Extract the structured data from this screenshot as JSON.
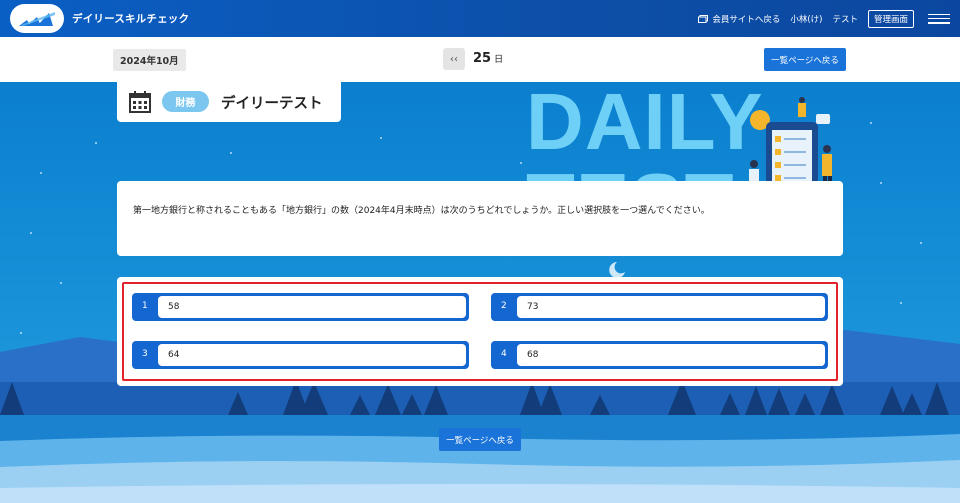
{
  "header": {
    "app_title": "デイリースキルチェック",
    "member_site": "会員サイトへ戻る",
    "user_name": "小林(け)",
    "test_link": "テスト",
    "admin_button": "管理画面"
  },
  "datebar": {
    "month": "2024年10月",
    "prev": "‹‹",
    "day": "25",
    "day_unit": "日",
    "list_button": "一覧ページへ戻る"
  },
  "card": {
    "category": "財務",
    "title": "デイリーテスト",
    "background_text": "DAILY TEST"
  },
  "question": {
    "text": "第一地方銀行と称されることもある「地方銀行」の数（2024年4月末時点）は次のうちどれでしょうか。正しい選択肢を一つ選んでください。"
  },
  "options": [
    {
      "num": "1",
      "value": "58"
    },
    {
      "num": "2",
      "value": "73"
    },
    {
      "num": "3",
      "value": "64"
    },
    {
      "num": "4",
      "value": "68"
    }
  ],
  "footer": {
    "list_button": "一覧ページへ戻る"
  },
  "colors": {
    "header": "#0d4fa8",
    "accent": "#1a73d9",
    "highlight": "#e0232b",
    "category": "#7cc7ef"
  }
}
